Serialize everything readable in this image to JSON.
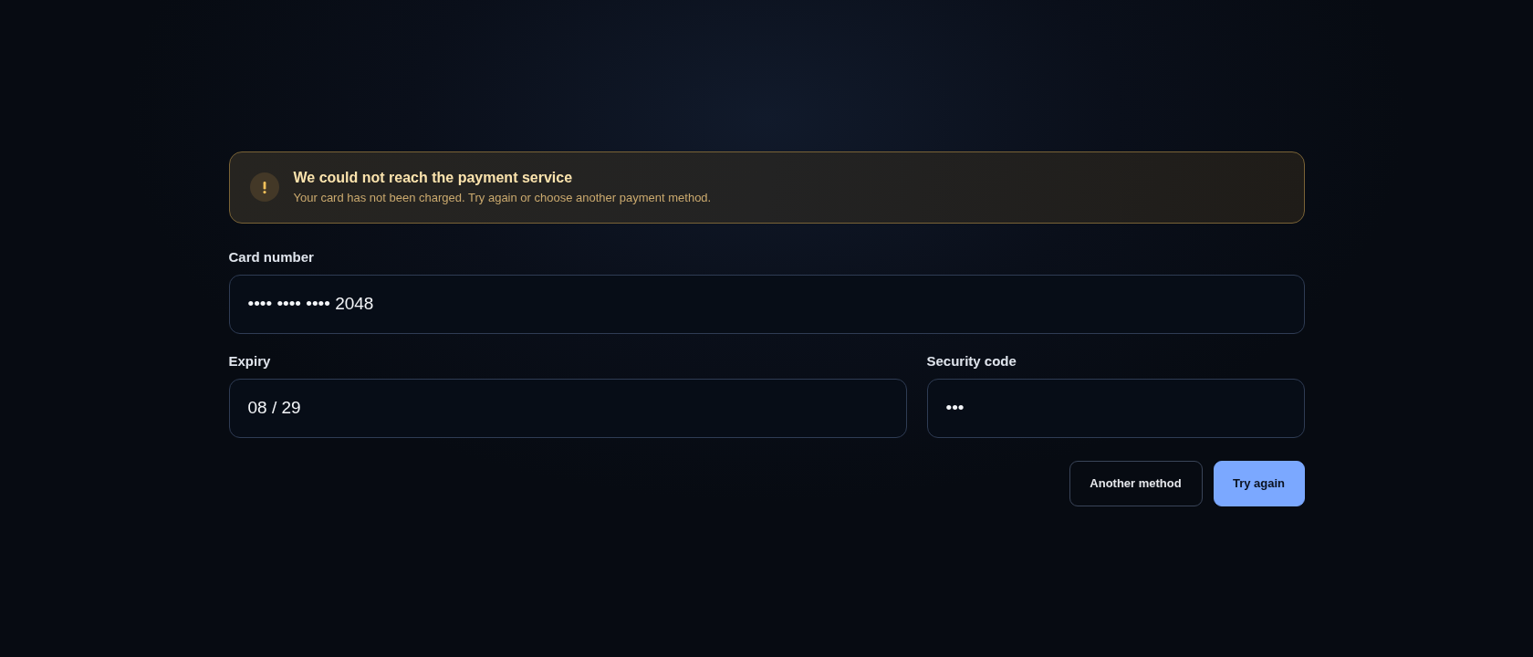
{
  "alert": {
    "kind": "warning",
    "title": "We could not reach the payment service",
    "message": "Your card has not been charged. Try again or choose another payment method."
  },
  "form": {
    "rows": [
      {
        "fields": [
          {
            "label": "Card number",
            "value": "•••• •••• •••• 2048"
          }
        ]
      },
      {
        "fields": [
          {
            "label": "Expiry",
            "value": "08 / 29"
          },
          {
            "label": "Security code",
            "value": "•••"
          }
        ]
      }
    ]
  },
  "buttons": [
    {
      "label": "Another method",
      "kind": "secondary"
    },
    {
      "label": "Try again",
      "kind": "primary"
    }
  ]
}
